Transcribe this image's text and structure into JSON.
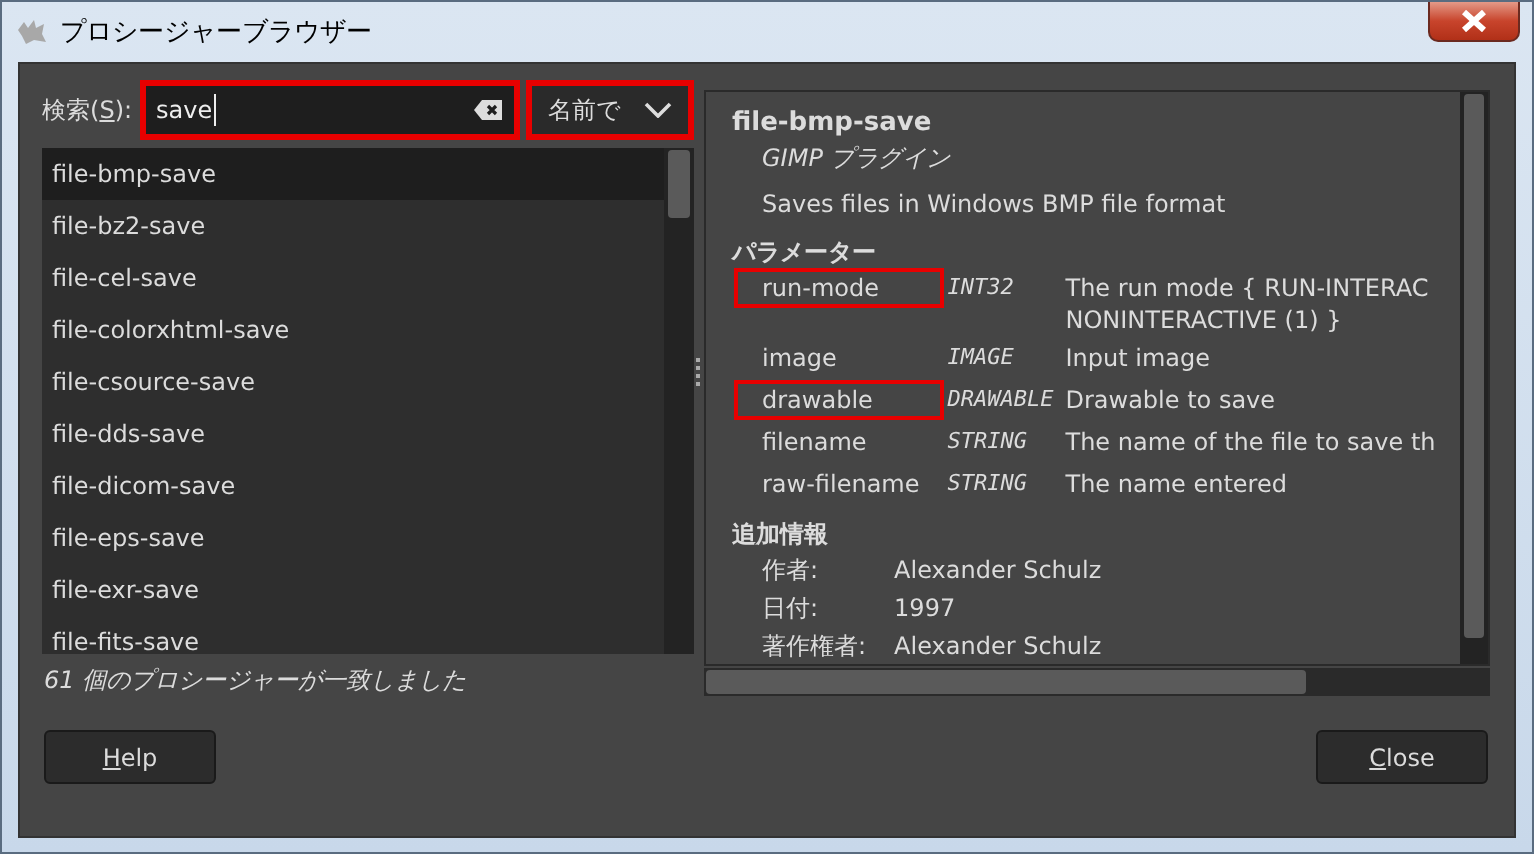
{
  "window": {
    "title": "プロシージャーブラウザー"
  },
  "search": {
    "label": {
      "before": "検索(",
      "key": "S",
      "after": "):"
    },
    "value": "save",
    "highlighted": true
  },
  "search_mode": {
    "value": "名前で",
    "highlighted": true
  },
  "procedures": [
    {
      "label": "file-bmp-save",
      "selected": true
    },
    {
      "label": "file-bz2-save",
      "selected": false
    },
    {
      "label": "file-cel-save",
      "selected": false
    },
    {
      "label": "file-colorxhtml-save",
      "selected": false
    },
    {
      "label": "file-csource-save",
      "selected": false
    },
    {
      "label": "file-dds-save",
      "selected": false
    },
    {
      "label": "file-dicom-save",
      "selected": false
    },
    {
      "label": "file-eps-save",
      "selected": false
    },
    {
      "label": "file-exr-save",
      "selected": false
    },
    {
      "label": "file-fits-save",
      "selected": false
    }
  ],
  "match_count": "61 個のプロシージャーが一致しました",
  "detail": {
    "name": "file-bmp-save",
    "kind": "GIMP プラグイン",
    "blurb": "Saves files in Windows BMP file format",
    "params_heading": "パラメーター",
    "params": [
      {
        "name": "run-mode",
        "type": "INT32",
        "description": [
          "The run mode { RUN-INTERAC",
          "NONINTERACTIVE (1) }"
        ],
        "highlighted": true
      },
      {
        "name": "image",
        "type": "IMAGE",
        "description": [
          "Input image"
        ],
        "highlighted": false
      },
      {
        "name": "drawable",
        "type": "DRAWABLE",
        "description": [
          "Drawable to save"
        ],
        "highlighted": true
      },
      {
        "name": "filename",
        "type": "STRING",
        "description": [
          "The name of the file to save th"
        ],
        "highlighted": false
      },
      {
        "name": "raw-filename",
        "type": "STRING",
        "description": [
          "The name entered"
        ],
        "highlighted": false
      }
    ],
    "info_heading": "追加情報",
    "info": [
      {
        "label": "作者:",
        "value": "Alexander Schulz"
      },
      {
        "label": "日付:",
        "value": "1997"
      },
      {
        "label": "著作権者:",
        "value": "Alexander Schulz"
      }
    ]
  },
  "buttons": [
    {
      "key": "H",
      "after": "elp"
    },
    {
      "key": "C",
      "after": "lose"
    }
  ]
}
